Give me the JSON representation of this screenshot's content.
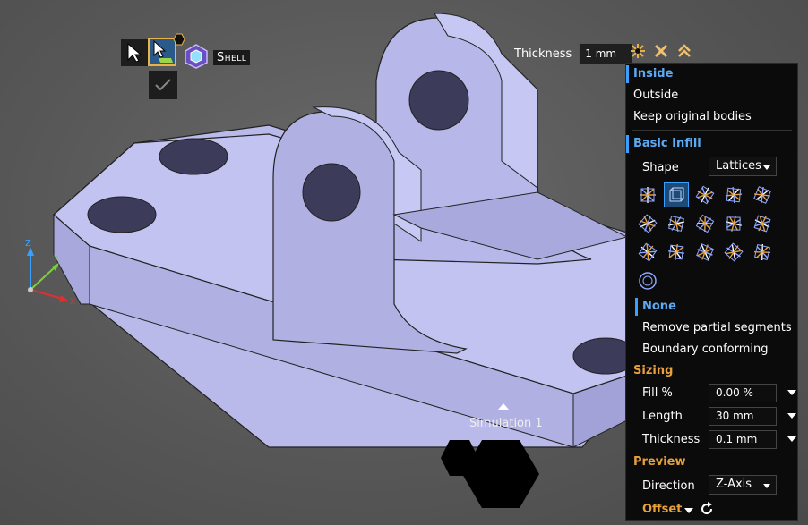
{
  "toolbar": {
    "tool_label": "Shell"
  },
  "thickness": {
    "label": "Thickness",
    "value": "1 mm"
  },
  "panel": {
    "direction_options": [
      "Inside",
      "Outside",
      "Keep original bodies"
    ],
    "selected_direction": "Inside",
    "section_basic_infill": "Basic Infill",
    "shape_label": "Shape",
    "shape_value": "Lattices",
    "lattice_icons": [
      "lattice-1",
      "lattice-2",
      "lattice-3",
      "lattice-4",
      "lattice-5",
      "lattice-6",
      "lattice-7",
      "lattice-8",
      "lattice-9",
      "lattice-10",
      "lattice-11",
      "lattice-12",
      "lattice-13",
      "lattice-14",
      "lattice-15",
      "lattice-16"
    ],
    "trim_options": [
      "None",
      "Remove partial segments",
      "Boundary conforming"
    ],
    "selected_trim": "None",
    "section_sizing": "Sizing",
    "fill_label": "Fill %",
    "fill_value": "0.00 %",
    "length_label": "Length",
    "length_value": "30 mm",
    "cell_thickness_label": "Thickness",
    "cell_thickness_value": "0.1 mm",
    "section_preview": "Preview",
    "direction_label": "Direction",
    "direction_value": "Z-Axis",
    "offset_label": "Offset"
  },
  "simulation": {
    "label": "Simulation 1"
  },
  "axes": {
    "z": "Z",
    "y": "Y",
    "x": "X"
  },
  "colors": {
    "accent_blue": "#3aa0ff",
    "section_orange": "#e8a03a",
    "model_fill": "#b4b4e6"
  }
}
